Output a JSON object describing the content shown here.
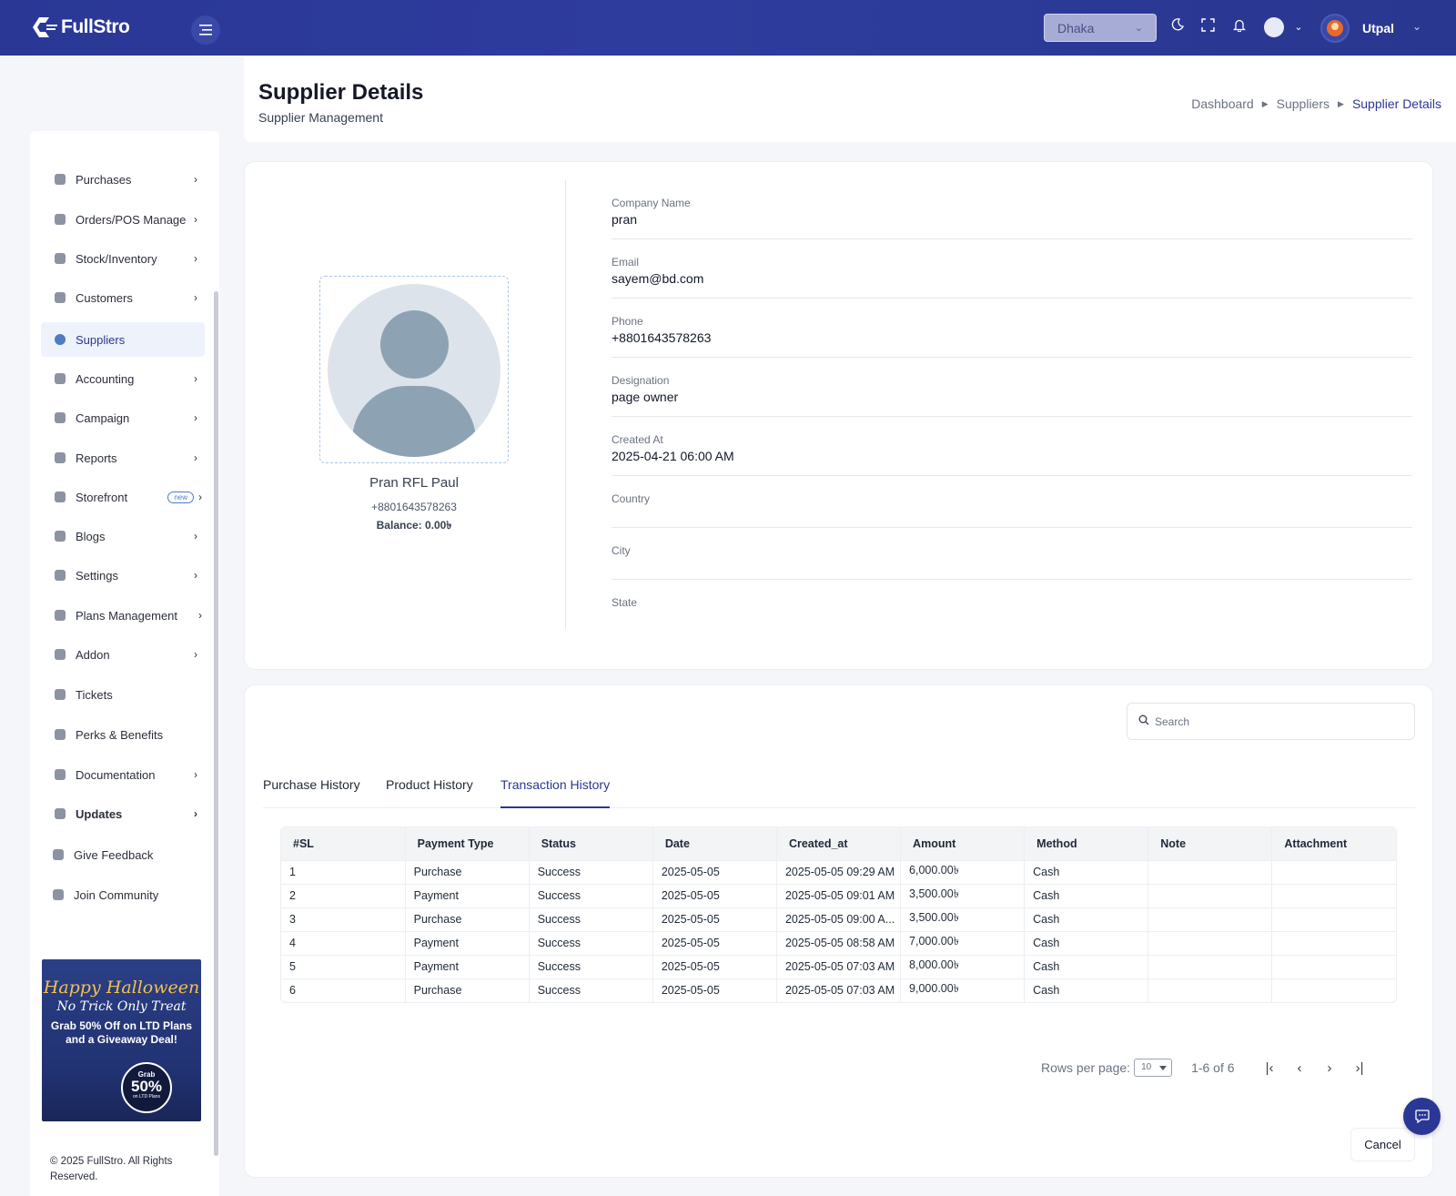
{
  "app": {
    "brand": "FullStro"
  },
  "topbar": {
    "location_select": "Dhaka",
    "user_name": "Utpal"
  },
  "sidebar": {
    "items": [
      {
        "label": "Purchases",
        "chevron": true
      },
      {
        "label": "Orders/POS Management",
        "chevron": true
      },
      {
        "label": "Stock/Inventory",
        "chevron": true
      },
      {
        "label": "Customers",
        "chevron": true
      },
      {
        "label": "Suppliers",
        "chevron": false,
        "active": true
      },
      {
        "label": "Accounting",
        "chevron": true
      },
      {
        "label": "Campaign",
        "chevron": true
      },
      {
        "label": "Reports",
        "chevron": true
      },
      {
        "label": "Storefront",
        "chevron": true,
        "badge": "new"
      },
      {
        "label": "Blogs",
        "chevron": true
      },
      {
        "label": "Settings",
        "chevron": true
      },
      {
        "label": "Plans Management",
        "chevron": true
      },
      {
        "label": "Addon",
        "chevron": true
      },
      {
        "label": "Tickets",
        "chevron": false
      },
      {
        "label": "Perks & Benefits",
        "chevron": false
      },
      {
        "label": "Documentation",
        "chevron": true
      },
      {
        "label": "Updates",
        "chevron": true
      },
      {
        "label": "Give Feedback",
        "chevron": false
      },
      {
        "label": "Join Community",
        "chevron": false
      }
    ],
    "promo": {
      "line1": "Happy Halloween",
      "line2": "No Trick Only Treat",
      "line3": "Grab 50% Off on LTD Plans and a Giveaway Deal!",
      "badge_top": "Grab",
      "badge_main": "50%",
      "badge_bottom": "on LTD Plans"
    },
    "copyright": "© 2025 FullStro. All Rights Reserved."
  },
  "page": {
    "title": "Supplier Details",
    "subtitle": "Supplier Management",
    "breadcrumb": [
      "Dashboard",
      "Suppliers",
      "Supplier Details"
    ]
  },
  "supplier": {
    "name": "Pran RFL Paul",
    "phone": "+8801643578263",
    "balance": "Balance: 0.00৳",
    "fields": [
      {
        "label": "Company Name",
        "value": "pran"
      },
      {
        "label": "Email",
        "value": "sayem@bd.com"
      },
      {
        "label": "Phone",
        "value": "+8801643578263"
      },
      {
        "label": "Designation",
        "value": "page owner"
      },
      {
        "label": "Created At",
        "value": "2025-04-21 06:00 AM"
      },
      {
        "label": "Country",
        "value": ""
      },
      {
        "label": "City",
        "value": ""
      },
      {
        "label": "State",
        "value": ""
      }
    ]
  },
  "history": {
    "search_placeholder": "Search",
    "tabs": [
      "Purchase History",
      "Product History",
      "Transaction History"
    ],
    "active_tab": "Transaction History",
    "columns": [
      "#SL",
      "Payment Type",
      "Status",
      "Date",
      "Created_at",
      "Amount",
      "Method",
      "Note",
      "Attachment"
    ],
    "rows": [
      [
        "1",
        "Purchase",
        "Success",
        "2025-05-05",
        "2025-05-05 09:29 AM",
        "6,000.00৳",
        "Cash",
        "",
        ""
      ],
      [
        "2",
        "Payment",
        "Success",
        "2025-05-05",
        "2025-05-05 09:01 AM",
        "3,500.00৳",
        "Cash",
        "",
        ""
      ],
      [
        "3",
        "Purchase",
        "Success",
        "2025-05-05",
        "2025-05-05 09:00 A...",
        "3,500.00৳",
        "Cash",
        "",
        ""
      ],
      [
        "4",
        "Payment",
        "Success",
        "2025-05-05",
        "2025-05-05 08:58 AM",
        "7,000.00৳",
        "Cash",
        "",
        ""
      ],
      [
        "5",
        "Payment",
        "Success",
        "2025-05-05",
        "2025-05-05 07:03 AM",
        "8,000.00৳",
        "Cash",
        "",
        ""
      ],
      [
        "6",
        "Purchase",
        "Success",
        "2025-05-05",
        "2025-05-05 07:03 AM",
        "9,000.00৳",
        "Cash",
        "",
        ""
      ]
    ],
    "rows_per_page_label": "Rows per page:",
    "rows_per_page": "10",
    "range": "1-6 of 6",
    "cancel_label": "Cancel"
  }
}
